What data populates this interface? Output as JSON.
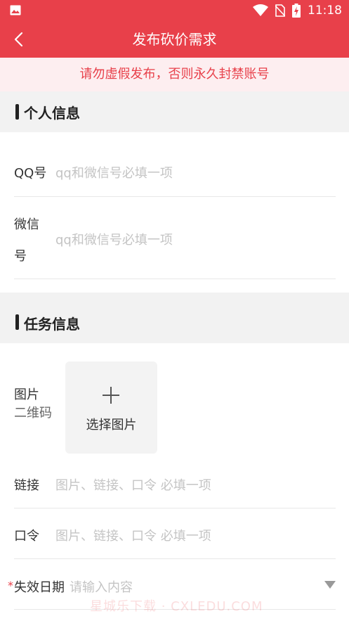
{
  "status_bar": {
    "time": "11:18",
    "icons": [
      "image-icon",
      "wifi-icon",
      "no-sim-icon",
      "battery-charging-icon"
    ]
  },
  "nav": {
    "title": "发布砍价需求",
    "back_icon": "chevron-left-icon"
  },
  "warning": {
    "text": "请勿虚假发布，否则永久封禁账号"
  },
  "personal_section": {
    "title": "个人信息",
    "qq": {
      "label": "QQ号",
      "placeholder": "qq和微信号必填一项"
    },
    "wechat": {
      "label_line1": "微信",
      "label_line2": "号",
      "placeholder": "qq和微信号必填一项"
    }
  },
  "task_section": {
    "title": "任务信息",
    "image": {
      "label": "图片",
      "sublabel": "二维码",
      "upload_text": "选择图片"
    },
    "link": {
      "label": "链接",
      "placeholder": "图片、链接、口令 必填一项"
    },
    "code": {
      "label": "口令",
      "placeholder": "图片、链接、口令 必填一项"
    },
    "expiry": {
      "required_mark": "*",
      "label": "失效日期",
      "placeholder": "请输入内容"
    }
  },
  "watermark": "星城乐下载 · CXLEDU.COM",
  "colors": {
    "primary": "#e8404a",
    "warning_bg": "#fdeef0",
    "section_bg": "#f2f2f2"
  }
}
